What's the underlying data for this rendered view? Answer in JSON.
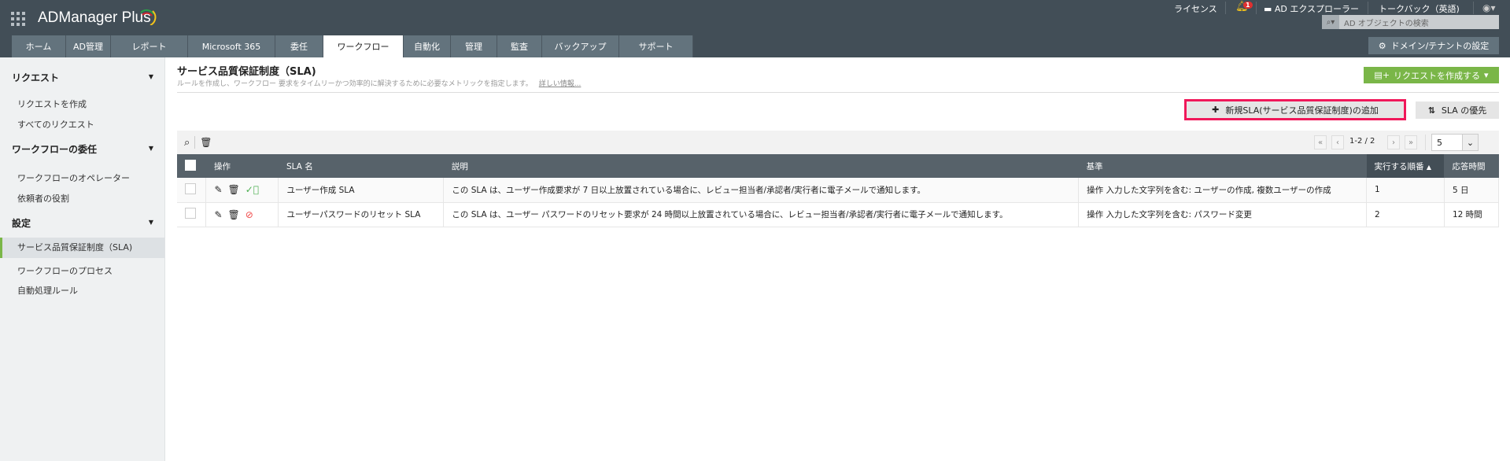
{
  "app": {
    "name": "ADManager Plus"
  },
  "topbar": {
    "license": "ライセンス",
    "notification_count": "1",
    "ad_explorer": "AD エクスプローラー",
    "talkback": "トークバック（英語)",
    "search_placeholder": "AD オブジェクトの検索",
    "domain_settings": "ドメイン/テナントの設定"
  },
  "tabs": [
    {
      "label": "ホーム"
    },
    {
      "label": "AD管理"
    },
    {
      "label": "レポート"
    },
    {
      "label": "Microsoft 365"
    },
    {
      "label": "委任"
    },
    {
      "label": "ワークフロー"
    },
    {
      "label": "自動化"
    },
    {
      "label": "管理"
    },
    {
      "label": "監査"
    },
    {
      "label": "バックアップ"
    },
    {
      "label": "サポート"
    }
  ],
  "sidebar": {
    "sections": [
      {
        "title": "リクエスト",
        "items": [
          "リクエストを作成",
          "すべてのリクエスト"
        ]
      },
      {
        "title": "ワークフローの委任",
        "items": [
          "ワークフローのオペレーター",
          "依頼者の役割"
        ]
      },
      {
        "title": "設定",
        "items": [
          "サービス品質保証制度（SLA)",
          "ワークフローのプロセス",
          "自動処理ルール"
        ]
      }
    ]
  },
  "page": {
    "title": "サービス品質保証制度（SLA)",
    "subtitle": "ルールを作成し、ワークフロー 要求をタイムリーかつ効率的に解決するために必要なメトリックを指定します。",
    "more_link": "詳しい情報...",
    "create_request": "リクエストを作成する",
    "add_sla": "新規SLA(サービス品質保証制度)の追加",
    "sla_priority": "SLA の優先"
  },
  "pagination": {
    "range": "1-2 / 2",
    "page_size": "5"
  },
  "table": {
    "headers": [
      "操作",
      "SLA 名",
      "説明",
      "基準",
      "実行する順番",
      "応答時間"
    ],
    "rows": [
      {
        "name": "ユーザー作成 SLA",
        "desc": "この SLA は、ユーザー作成要求が 7 日以上放置されている場合に、レビュー担当者/承認者/実行者に電子メールで通知します。",
        "criteria": "操作 入力した文字列を含む: ユーザーの作成, 複数ユーザーの作成",
        "order": "1",
        "time": "5 日",
        "status": "enabled"
      },
      {
        "name": "ユーザーパスワードのリセット SLA",
        "desc": "この SLA は、ユーザー パスワードのリセット要求が 24 時間以上放置されている場合に、レビュー担当者/承認者/実行者に電子メールで通知します。",
        "criteria": "操作 入力した文字列を含む: パスワード変更",
        "order": "2",
        "time": "12 時間",
        "status": "disabled"
      }
    ]
  }
}
